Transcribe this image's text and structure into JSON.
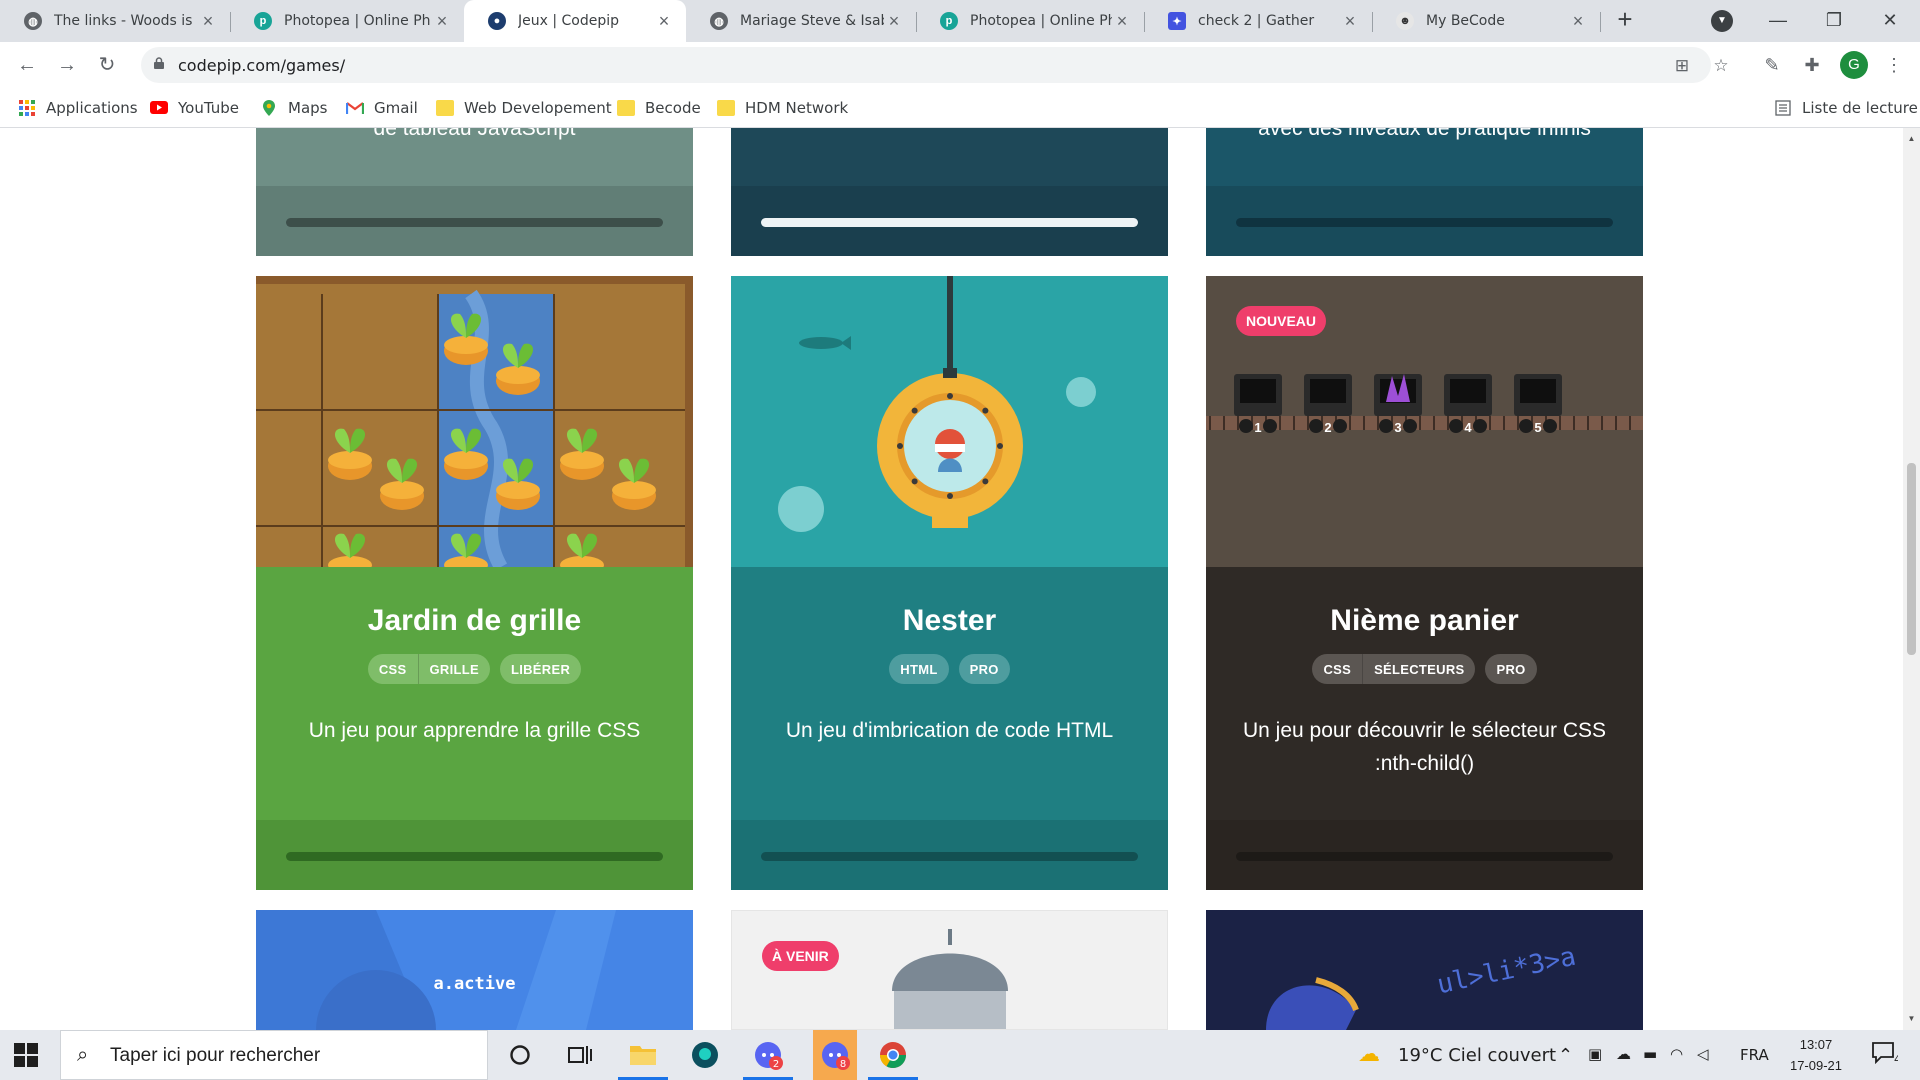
{
  "browser": {
    "tabs": [
      {
        "title": "The links - Woods is h",
        "icon": "globe-icon",
        "active": false
      },
      {
        "title": "Photopea | Online Ph",
        "icon": "photopea-icon",
        "active": false
      },
      {
        "title": "Jeux | Codepip",
        "icon": "codepip-icon",
        "active": true
      },
      {
        "title": "Mariage Steve & Isab",
        "icon": "globe-icon",
        "active": false
      },
      {
        "title": "Photopea | Online Ph",
        "icon": "photopea-icon",
        "active": false
      },
      {
        "title": "check 2 | Gather",
        "icon": "gather-icon",
        "active": false
      },
      {
        "title": "My BeCode",
        "icon": "becode-icon",
        "active": false
      }
    ],
    "url": "codepip.com/games/",
    "bookmarks": [
      {
        "label": "Applications",
        "icon": "apps-grid-icon"
      },
      {
        "label": "YouTube",
        "icon": "youtube-icon"
      },
      {
        "label": "Maps",
        "icon": "maps-icon"
      },
      {
        "label": "Gmail",
        "icon": "gmail-icon"
      },
      {
        "label": "Web Developement",
        "icon": "folder-icon"
      },
      {
        "label": "Becode",
        "icon": "folder-icon"
      },
      {
        "label": "HDM Network",
        "icon": "folder-icon"
      }
    ],
    "reading_list": "Liste de lecture",
    "profile_initial": "G"
  },
  "page": {
    "top_row": [
      {
        "desc_fragment": "de tableau JavaScript",
        "bg": "#6f8f86",
        "footer": "#617e76",
        "bar": "#3d4f4a"
      },
      {
        "desc_fragment": "",
        "bg": "#1e4858",
        "footer": "#1a3f4e",
        "bar": "#eef3f5"
      },
      {
        "desc_fragment": "avec des niveaux de pratique infinis",
        "bg": "#1b5668",
        "footer": "#184b5b",
        "bar": "#0f3340"
      }
    ],
    "games": [
      {
        "title": "Jardin de grille",
        "tag_groups": [
          [
            "CSS",
            "GRILLE"
          ],
          [
            "LIBÉRER"
          ]
        ],
        "description": "Un jeu pour apprendre la grille CSS",
        "bg": "#5aa541",
        "footer": "#4f9438",
        "tag_bg": "#7fbd69",
        "bar": "#2f6a22"
      },
      {
        "title": "Nester",
        "tag_groups": [
          [
            "HTML"
          ],
          [
            "PRO"
          ]
        ],
        "description": "Un jeu d'imbrication de code HTML",
        "bg": "#1f7f82",
        "footer": "#1b7174",
        "tag_bg": "#4e9d9f",
        "bar": "#125052"
      },
      {
        "title": "Nième panier",
        "badge": "NOUVEAU",
        "tag_groups": [
          [
            "CSS",
            "SÉLECTEURS"
          ],
          [
            "PRO"
          ]
        ],
        "description": "Un jeu pour découvrir le sélecteur CSS :nth-child()",
        "bg": "#2f2a26",
        "footer": "#2a2521",
        "tag_bg": "#5b5652",
        "bar": "#1d1a17",
        "carts": [
          "1",
          "2",
          "3",
          "4",
          "5"
        ]
      }
    ],
    "bottom_row": [
      {
        "art_text": "a.active",
        "bg": "#4585e6"
      },
      {
        "badge": "À VENIR",
        "bg": "#f1f1f1"
      },
      {
        "art_text": "ul>li*3>a",
        "bg": "#1b2245"
      }
    ]
  },
  "taskbar": {
    "search_placeholder": "Taper ici pour rechercher",
    "apps": [
      {
        "name": "cortana-icon"
      },
      {
        "name": "task-view-icon"
      },
      {
        "name": "file-explorer-icon"
      },
      {
        "name": "gitkraken-icon"
      },
      {
        "name": "discord-icon",
        "badge": "2"
      },
      {
        "name": "discord-canary-icon",
        "badge": "8"
      },
      {
        "name": "chrome-icon"
      }
    ],
    "weather": "19°C  Ciel couvert",
    "language": "FRA",
    "time": "13:07",
    "date": "17-09-21",
    "notifications": "4"
  }
}
